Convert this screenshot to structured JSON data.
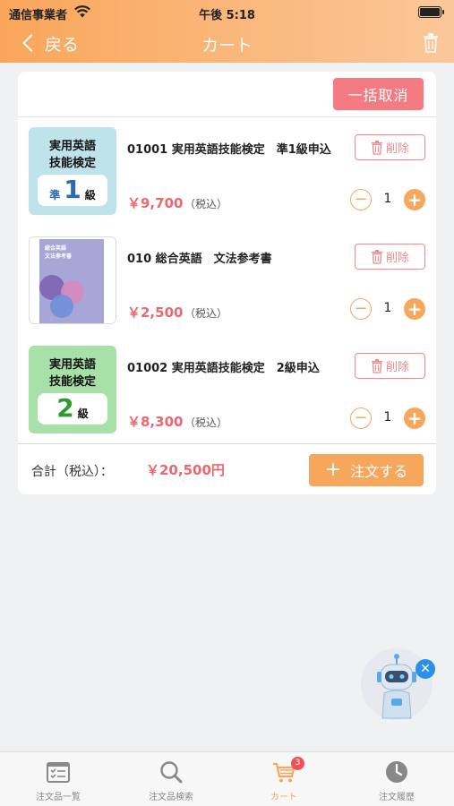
{
  "status_bar": {
    "carrier": "通信事業者",
    "time": "午後 5:18"
  },
  "nav": {
    "back_label": "戻る",
    "title": "カート",
    "trash_icon": "trash-icon"
  },
  "cart": {
    "bulk_cancel_label": "一括取消",
    "items": [
      {
        "thumb": {
          "type": "exam",
          "title_line1": "実用英語",
          "title_line2": "技能検定",
          "prefix": "準",
          "number": "1",
          "suffix": "級",
          "color": "#bfe3ea"
        },
        "title": "01001 実用英語技能検定　準1級申込",
        "price": "￥9,700",
        "tax": "（税込）",
        "delete_label": "削除",
        "quantity": "1"
      },
      {
        "thumb": {
          "type": "book",
          "title_line1": "総合英語",
          "title_line2": "文法参考書",
          "color": "#a8a6d6"
        },
        "title": "010 総合英語　文法参考書",
        "price": "￥2,500",
        "tax": "（税込）",
        "delete_label": "削除",
        "quantity": "1"
      },
      {
        "thumb": {
          "type": "exam",
          "title_line1": "実用英語",
          "title_line2": "技能検定",
          "number": "2",
          "suffix": "級",
          "color": "#a8e1a8"
        },
        "title": "01002 実用英語技能検定　2級申込",
        "price": "￥8,300",
        "tax": "（税込）",
        "delete_label": "削除",
        "quantity": "1"
      }
    ],
    "total_label": "合計（税込）：",
    "total_value": "￥20,500円",
    "order_label": "注文する"
  },
  "tabbar": {
    "tabs": [
      {
        "label": "注文品一覧",
        "icon": "list-icon"
      },
      {
        "label": "注文品検索",
        "icon": "search-icon"
      },
      {
        "label": "カート",
        "icon": "cart-icon",
        "badge": "3",
        "active": true
      },
      {
        "label": "注文履歴",
        "icon": "clock-icon"
      }
    ]
  },
  "colors": {
    "accent": "#f6a75b",
    "price": "#f0666e",
    "danger": "#f47b81"
  }
}
